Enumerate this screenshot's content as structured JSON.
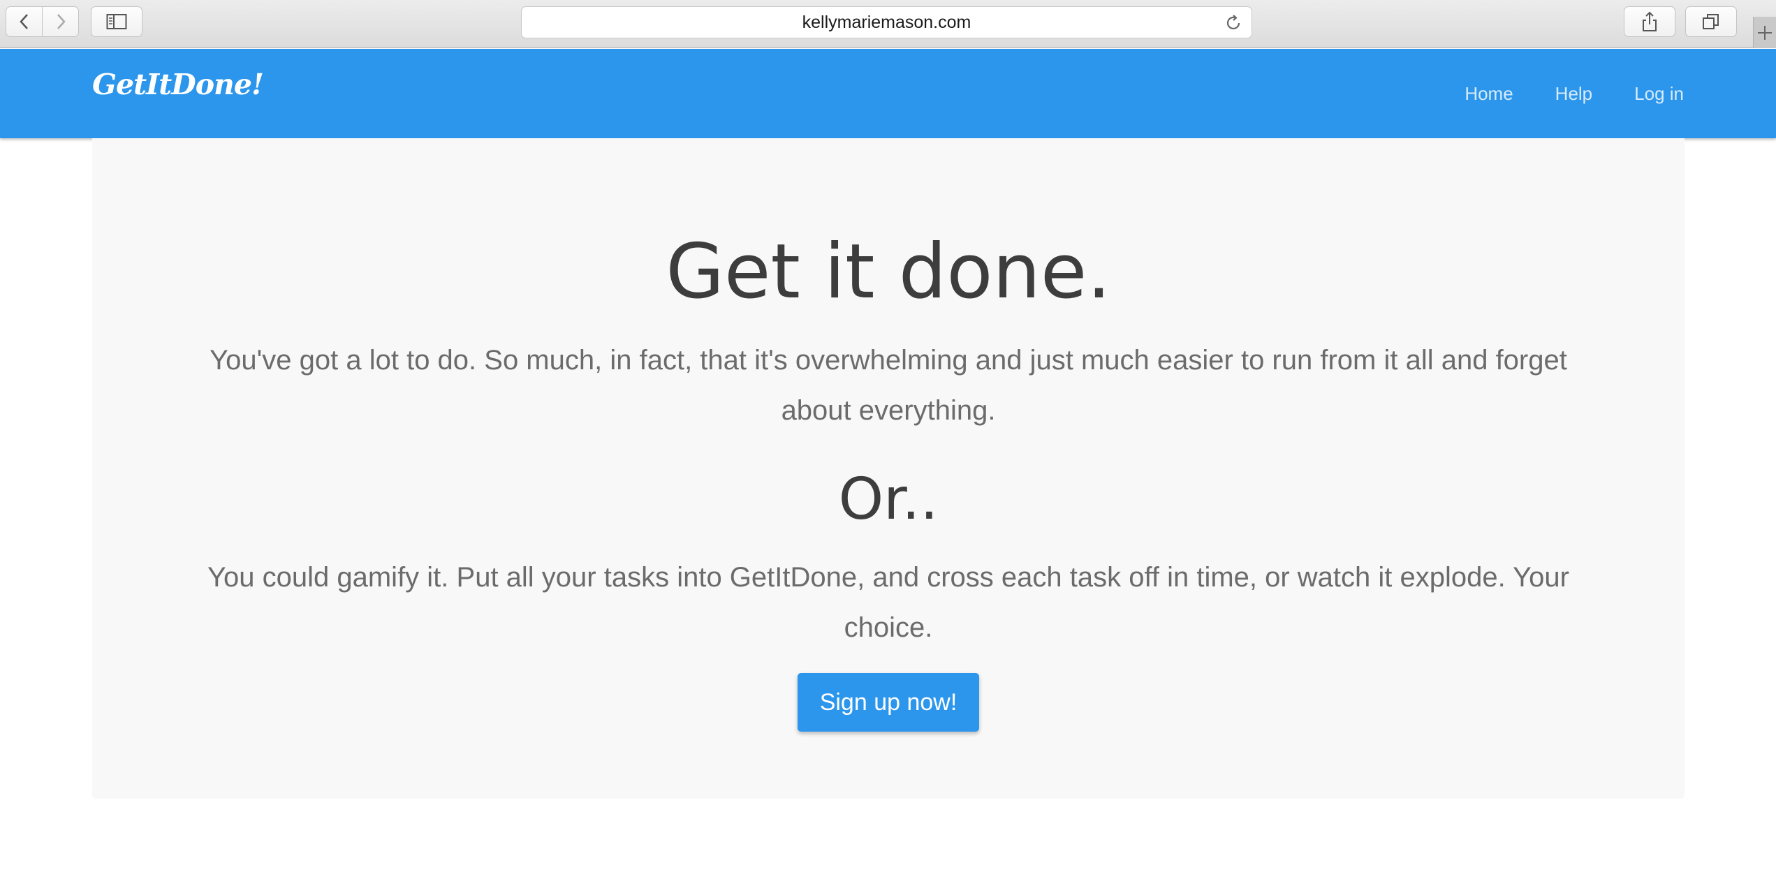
{
  "browser": {
    "url": "kellymariemason.com",
    "icons": {
      "back": "chevron-left-icon",
      "forward": "chevron-right-icon",
      "sidebar": "sidebar-icon",
      "reload": "reload-icon",
      "share": "share-icon",
      "tabs": "tabs-overview-icon",
      "new_tab": "plus-icon"
    }
  },
  "navbar": {
    "brand": "GetItDone!",
    "links": [
      "Home",
      "Help",
      "Log in"
    ],
    "background_color": "#2b96ec"
  },
  "hero": {
    "headline": "Get it done.",
    "lead_1": "You've got a lot to do. So much, in fact, that it's overwhelming and just much easier to run from it all and forget about everything.",
    "subhead": "Or..",
    "lead_2": "You could gamify it. Put all your tasks into GetItDone, and cross each task off in time, or watch it explode. Your choice.",
    "cta_label": "Sign up now!",
    "cta_color": "#2b96ec"
  }
}
